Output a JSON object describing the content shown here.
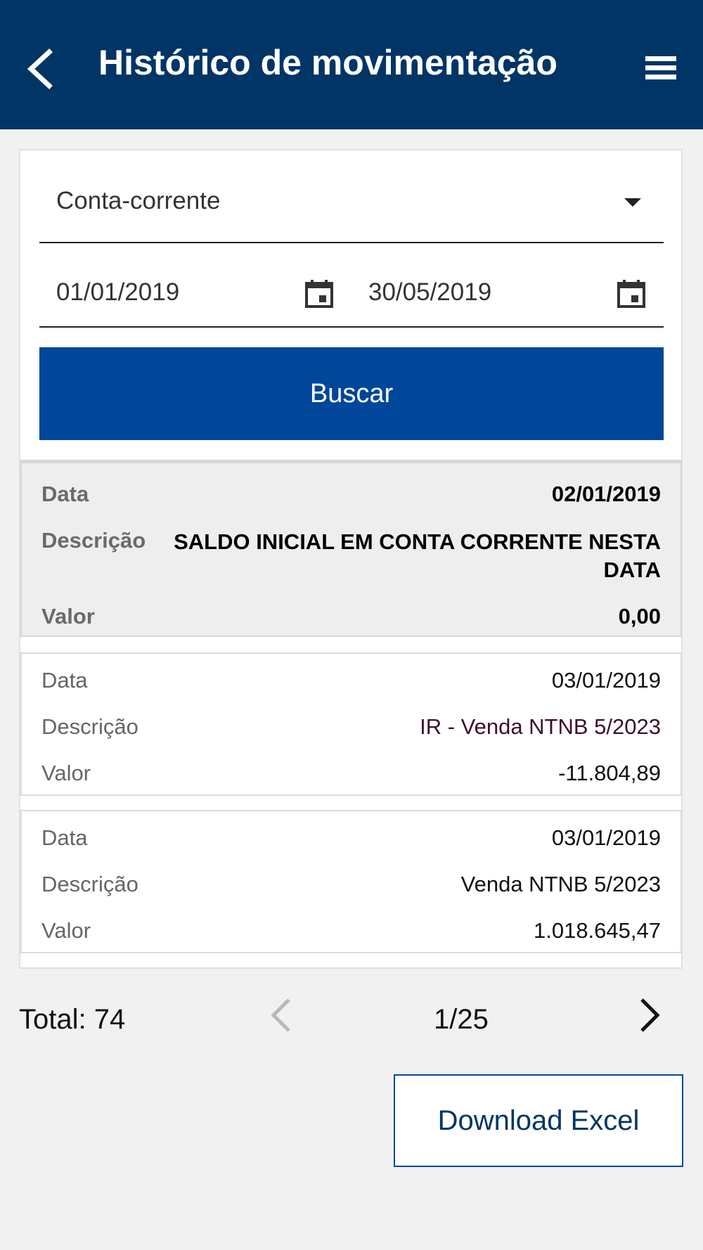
{
  "header": {
    "title": "Histórico de movimentação",
    "back_icon": "chevron-left-icon",
    "menu_icon": "hamburger-menu-icon"
  },
  "filter": {
    "account_type": "Conta-corrente",
    "start_date": "01/01/2019",
    "end_date": "30/05/2019",
    "search_label": "Buscar"
  },
  "transactions": [
    {
      "date_label": "Data",
      "date": "02/01/2019",
      "desc_label": "Descrição",
      "description": "SALDO INICIAL EM CONTA CORRENTE NESTA DATA",
      "value_label": "Valor",
      "value": "0,00"
    },
    {
      "date_label": "Data",
      "date": "03/01/2019",
      "desc_label": "Descrição",
      "description": "IR - Venda NTNB 5/2023",
      "value_label": "Valor",
      "value": "-11.804,89"
    },
    {
      "date_label": "Data",
      "date": "03/01/2019",
      "desc_label": "Descrição",
      "description": "Venda NTNB 5/2023",
      "value_label": "Valor",
      "value": "1.018.645,47"
    }
  ],
  "pagination": {
    "total_label": "Total: 74",
    "page_label": "1/25"
  },
  "download_label": "Download Excel",
  "colors": {
    "header_bg": "#003566",
    "primary_button": "#00469b",
    "page_bg": "#f1f1f1"
  }
}
